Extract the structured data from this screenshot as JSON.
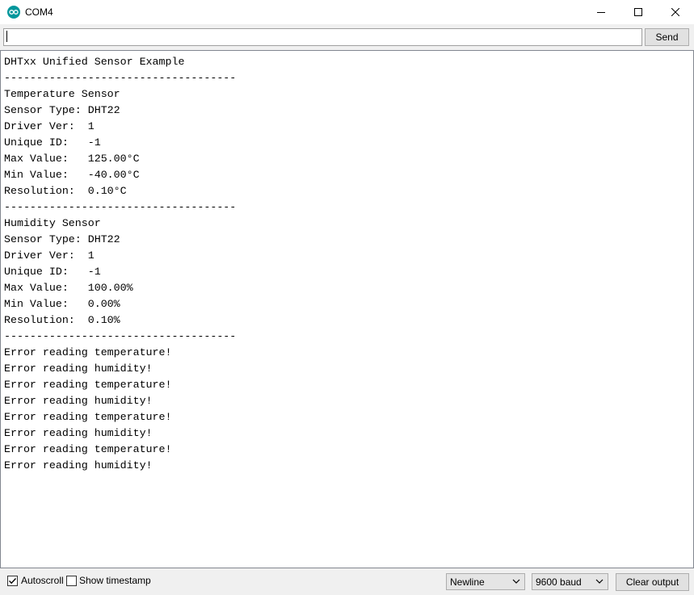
{
  "window": {
    "title": "COM4",
    "icon": "arduino-infinity-icon",
    "controls": [
      "minimize-icon",
      "maximize-icon",
      "close-icon"
    ]
  },
  "input": {
    "value": "",
    "send_label": "Send"
  },
  "output": {
    "lines": [
      "DHTxx Unified Sensor Example",
      "------------------------------------",
      "Temperature Sensor",
      "Sensor Type: DHT22",
      "Driver Ver:  1",
      "Unique ID:   -1",
      "Max Value:   125.00°C",
      "Min Value:   -40.00°C",
      "Resolution:  0.10°C",
      "------------------------------------",
      "Humidity Sensor",
      "Sensor Type: DHT22",
      "Driver Ver:  1",
      "Unique ID:   -1",
      "Max Value:   100.00%",
      "Min Value:   0.00%",
      "Resolution:  0.10%",
      "------------------------------------",
      "Error reading temperature!",
      "Error reading humidity!",
      "Error reading temperature!",
      "Error reading humidity!",
      "Error reading temperature!",
      "Error reading humidity!",
      "Error reading temperature!",
      "Error reading humidity!"
    ]
  },
  "bottom": {
    "autoscroll_label": "Autoscroll",
    "autoscroll_checked": true,
    "timestamp_label": "Show timestamp",
    "timestamp_checked": false,
    "line_ending": "Newline",
    "baud_rate": "9600 baud",
    "clear_label": "Clear output"
  },
  "colors": {
    "arduino_teal": "#00979c",
    "window_bg": "#f0f0f0",
    "button_bg": "#e1e1e1",
    "border": "#adadad"
  }
}
